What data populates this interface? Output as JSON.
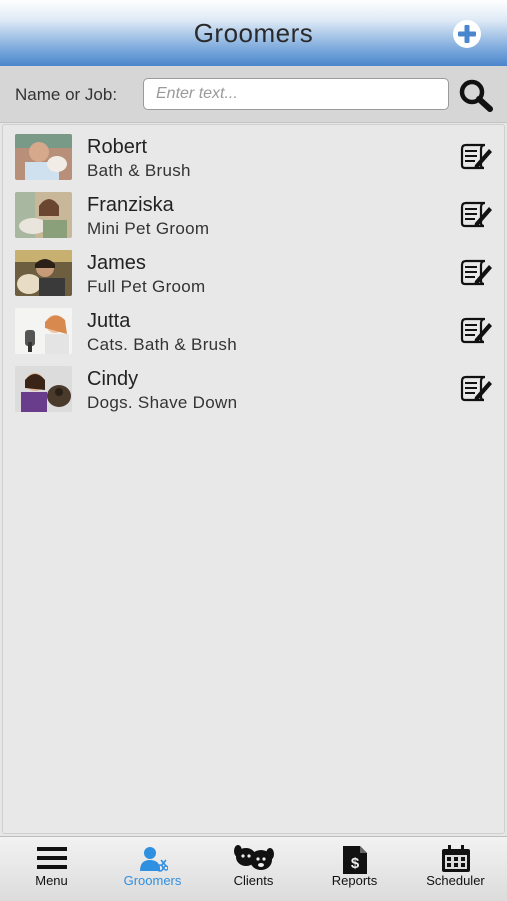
{
  "header": {
    "title": "Groomers",
    "add_icon": "plus-circle-icon"
  },
  "search": {
    "label": "Name or Job:",
    "placeholder": "Enter text...",
    "value": ""
  },
  "groomers": [
    {
      "name": "Robert",
      "job": "Bath & Brush"
    },
    {
      "name": "Franziska",
      "job": "Mini Pet Groom"
    },
    {
      "name": "James",
      "job": "Full Pet Groom"
    },
    {
      "name": "Jutta",
      "job": "Cats. Bath & Brush"
    },
    {
      "name": "Cindy",
      "job": "Dogs. Shave Down"
    }
  ],
  "tabs": [
    {
      "label": "Menu",
      "icon": "hamburger-icon"
    },
    {
      "label": "Groomers",
      "icon": "groomer-icon",
      "active": true
    },
    {
      "label": "Clients",
      "icon": "paw-dogs-icon"
    },
    {
      "label": "Reports",
      "icon": "report-document-icon"
    },
    {
      "label": "Scheduler",
      "icon": "calendar-icon"
    }
  ],
  "colors": {
    "accent": "#2f8fe0",
    "header_blue": "#4a86cc",
    "background": "#e6e6e6"
  }
}
